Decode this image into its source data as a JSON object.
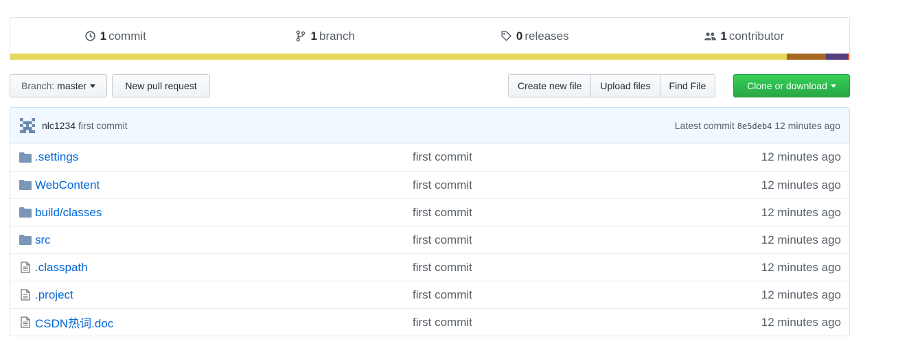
{
  "summary": {
    "commits": {
      "count": "1",
      "label": "commit"
    },
    "branches": {
      "count": "1",
      "label": "branch"
    },
    "releases": {
      "count": "0",
      "label": "releases"
    },
    "contributors": {
      "count": "1",
      "label": "contributor"
    }
  },
  "language_bar": [
    {
      "color": "#e7d75b",
      "share": 93.2
    },
    {
      "color": "#a4691f",
      "share": 4.7
    },
    {
      "color": "#563d7c",
      "share": 2.6
    },
    {
      "color": "#e34c26",
      "share": 0.2
    }
  ],
  "actions": {
    "branch_label": "Branch:",
    "branch_value": "master",
    "new_pull_request": "New pull request",
    "create_new_file": "Create new file",
    "upload_files": "Upload files",
    "find_file": "Find File",
    "clone_or_download": "Clone or download"
  },
  "latest_commit": {
    "author": "nlc1234",
    "message": "first commit",
    "label": "Latest commit",
    "sha": "8e5deb4",
    "age": "12 minutes ago"
  },
  "files": [
    {
      "type": "folder",
      "name": ".settings",
      "message": "first commit",
      "age": "12 minutes ago"
    },
    {
      "type": "folder",
      "name": "WebContent",
      "message": "first commit",
      "age": "12 minutes ago"
    },
    {
      "type": "folder",
      "name": "build/classes",
      "message": "first commit",
      "age": "12 minutes ago"
    },
    {
      "type": "folder",
      "name": "src",
      "message": "first commit",
      "age": "12 minutes ago"
    },
    {
      "type": "file",
      "name": ".classpath",
      "message": "first commit",
      "age": "12 minutes ago"
    },
    {
      "type": "file",
      "name": ".project",
      "message": "first commit",
      "age": "12 minutes ago"
    },
    {
      "type": "file",
      "name": "CSDN热词.doc",
      "message": "first commit",
      "age": "12 minutes ago"
    }
  ],
  "colors": {
    "link": "#0366d6",
    "green": "#28a745",
    "commit_bar_bg": "#f1f8ff",
    "icon": "#6a8aab"
  }
}
